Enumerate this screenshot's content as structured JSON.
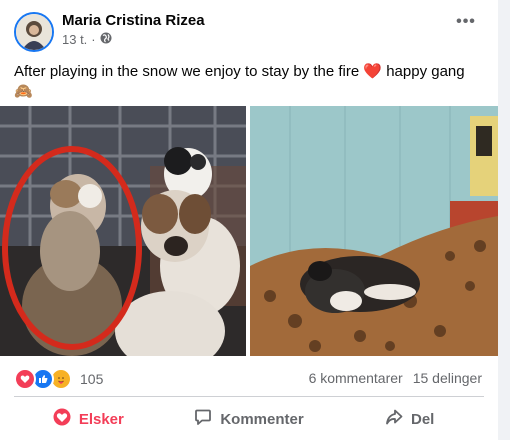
{
  "post": {
    "author": "Maria Cristina Rizea",
    "time": "13 t.",
    "separator": "·",
    "text": "After playing in the snow we enjoy to stay by the fire ❤️ happy gang 🙈",
    "more_label": "•••"
  },
  "reactions": {
    "types": [
      "love-icon",
      "like-icon",
      "care-icon"
    ],
    "count": "105",
    "comments": "6 kommentarer",
    "shares": "15 delinger"
  },
  "actions": {
    "love_label": "Elsker",
    "comment_label": "Kommenter",
    "share_label": "Del"
  },
  "colors": {
    "like": "#1877f2",
    "love": "#f33e58",
    "care": "#f7b125",
    "circle_annotation": "#d42a1c"
  }
}
